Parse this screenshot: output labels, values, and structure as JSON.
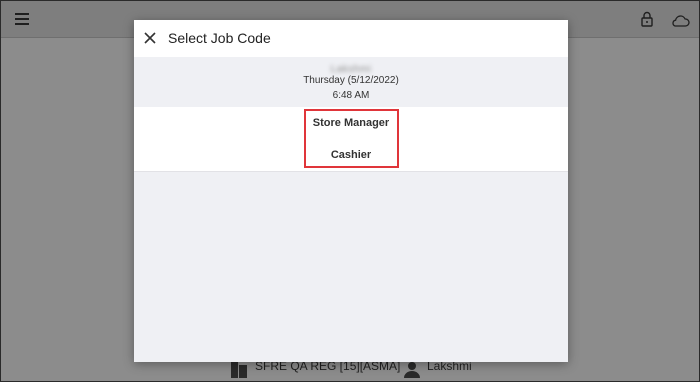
{
  "background": {
    "footer_terminal": "SFRE QA REG [15][ASMA]",
    "footer_user": "Lakshmi"
  },
  "dialog": {
    "title": "Select Job Code",
    "employee_name": "Lakshmi",
    "date": "Thursday (5/12/2022)",
    "time": "6:48 AM",
    "jobs": [
      {
        "label": "Store Manager"
      },
      {
        "label": "Cashier"
      }
    ]
  },
  "colors": {
    "highlight": "#e0353a",
    "overlay": "#8c8c8c",
    "dialog_bg": "#eff0f4"
  },
  "icons": {
    "menu": "hamburger-menu-icon",
    "lock": "lock-icon",
    "cloud": "cloud-icon",
    "close": "close-icon",
    "terminal": "terminal-icon",
    "user": "user-icon"
  }
}
